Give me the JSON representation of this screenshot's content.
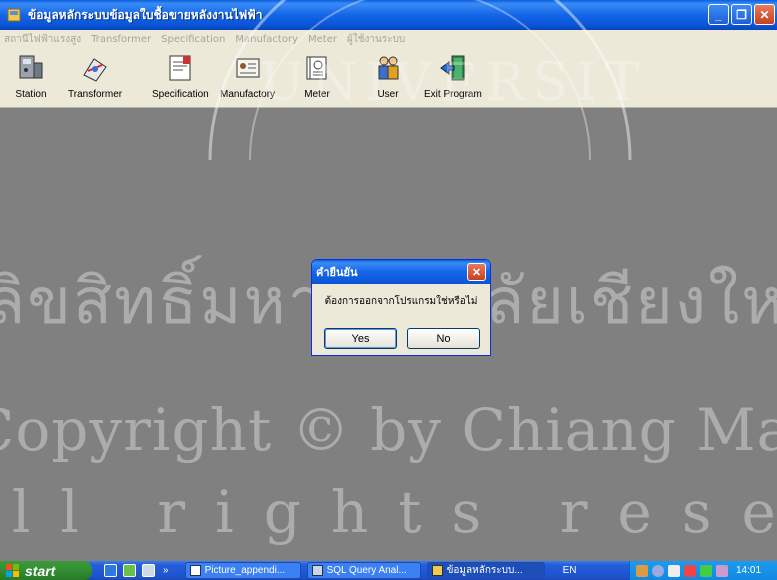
{
  "window": {
    "title": "ข้อมูลหลักระบบข้อมูลใบชื้อขายหลังงานไฟฟ้า",
    "minimize_icon": "minimize-icon",
    "restore_icon": "restore-icon",
    "close_icon": "close-icon"
  },
  "menu": {
    "items": [
      {
        "label": "สถานีไฟฟ้าแรงสูง"
      },
      {
        "label": "Transformer"
      },
      {
        "label": "Specification"
      },
      {
        "label": "Manufactory"
      },
      {
        "label": "Meter"
      },
      {
        "label": "ผู้ใช้งานระบบ"
      }
    ]
  },
  "toolbar": {
    "items": [
      {
        "label": "Station",
        "icon": "station-icon"
      },
      {
        "label": "Transformer",
        "icon": "transformer-icon"
      },
      {
        "label": "Specification",
        "icon": "specification-icon"
      },
      {
        "label": "Manufactory",
        "icon": "manufactory-icon"
      },
      {
        "label": "Meter",
        "icon": "meter-icon"
      },
      {
        "label": "User",
        "icon": "user-icon"
      },
      {
        "label": "Exit Program",
        "icon": "exit-icon"
      }
    ]
  },
  "dialog": {
    "title": "คำยืนยัน",
    "message": "ต้องการออกจากโปรแกรมใช่หรือไม่",
    "yes_label": "Yes",
    "no_label": "No"
  },
  "taskbar": {
    "start_label": "start",
    "tasks": [
      {
        "label": "Picture_appendi..."
      },
      {
        "label": "SQL Query Anal..."
      },
      {
        "label": "ข้อมูลหลักระบบ..."
      }
    ],
    "language": "EN",
    "clock": "14:01"
  },
  "watermark": {
    "line1": "ลิขสิทธิ์มหาวิทยาลัยเชียงใหม่",
    "line2": "Copyright © by Chiang Mai University",
    "line3": "All rights reserved",
    "seal_text": "CHIANG MAI UNIVERSITY"
  },
  "colors": {
    "titlebar": "#0a54d6",
    "workspace": "#808080",
    "dialog_bg": "#ece9d8",
    "taskbar": "#245edb",
    "start_button": "#2f8a2f"
  }
}
